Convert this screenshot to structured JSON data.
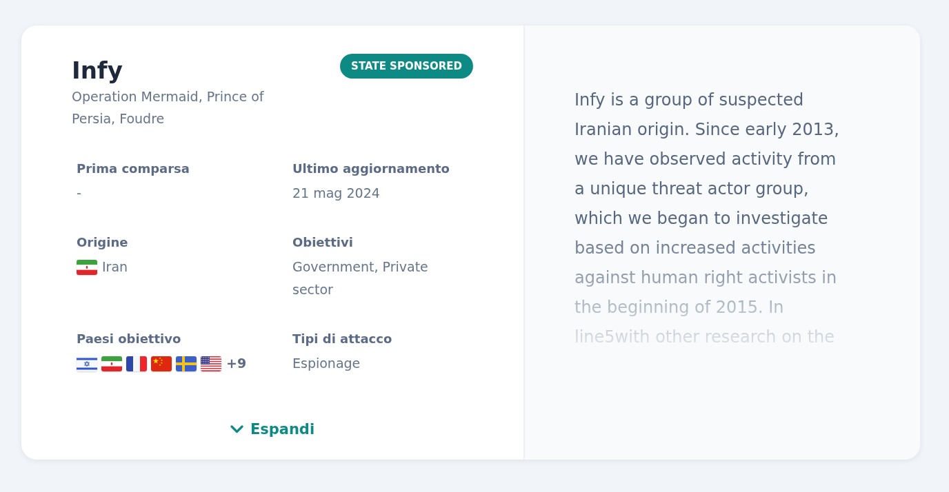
{
  "actor": {
    "name": "Infy",
    "badge": "STATE SPONSORED",
    "aliases": "Operation Mermaid, Prince of Persia, Foudre",
    "details": [
      {
        "kind": "text",
        "label": "Prima comparsa",
        "value": "-"
      },
      {
        "kind": "text",
        "label": "Ultimo aggiornamento",
        "value": "21 mag 2024"
      },
      {
        "kind": "country",
        "label": "Origine",
        "flag": {
          "kind": "iran"
        },
        "value": "Iran"
      },
      {
        "kind": "text",
        "label": "Obiettivi",
        "value": "Government, Private sector"
      },
      {
        "kind": "flags",
        "label": "Paesi obiettivo",
        "flags": [
          {
            "kind": "israel"
          },
          {
            "kind": "iran"
          },
          {
            "kind": "france"
          },
          {
            "kind": "china"
          },
          {
            "kind": "sweden"
          },
          {
            "kind": "usa"
          }
        ],
        "more": "+9"
      },
      {
        "kind": "text",
        "label": "Tipi di attacco",
        "value": "Espionage"
      }
    ],
    "expand_button": "Espandi"
  },
  "description": "Infy is a group of suspected Iranian origin. Since early 2013, we have observed activity from a unique threat actor group, which we began to investigate based on increased activities against human right activists in the beginning of 2015. In line5with other research on the"
}
